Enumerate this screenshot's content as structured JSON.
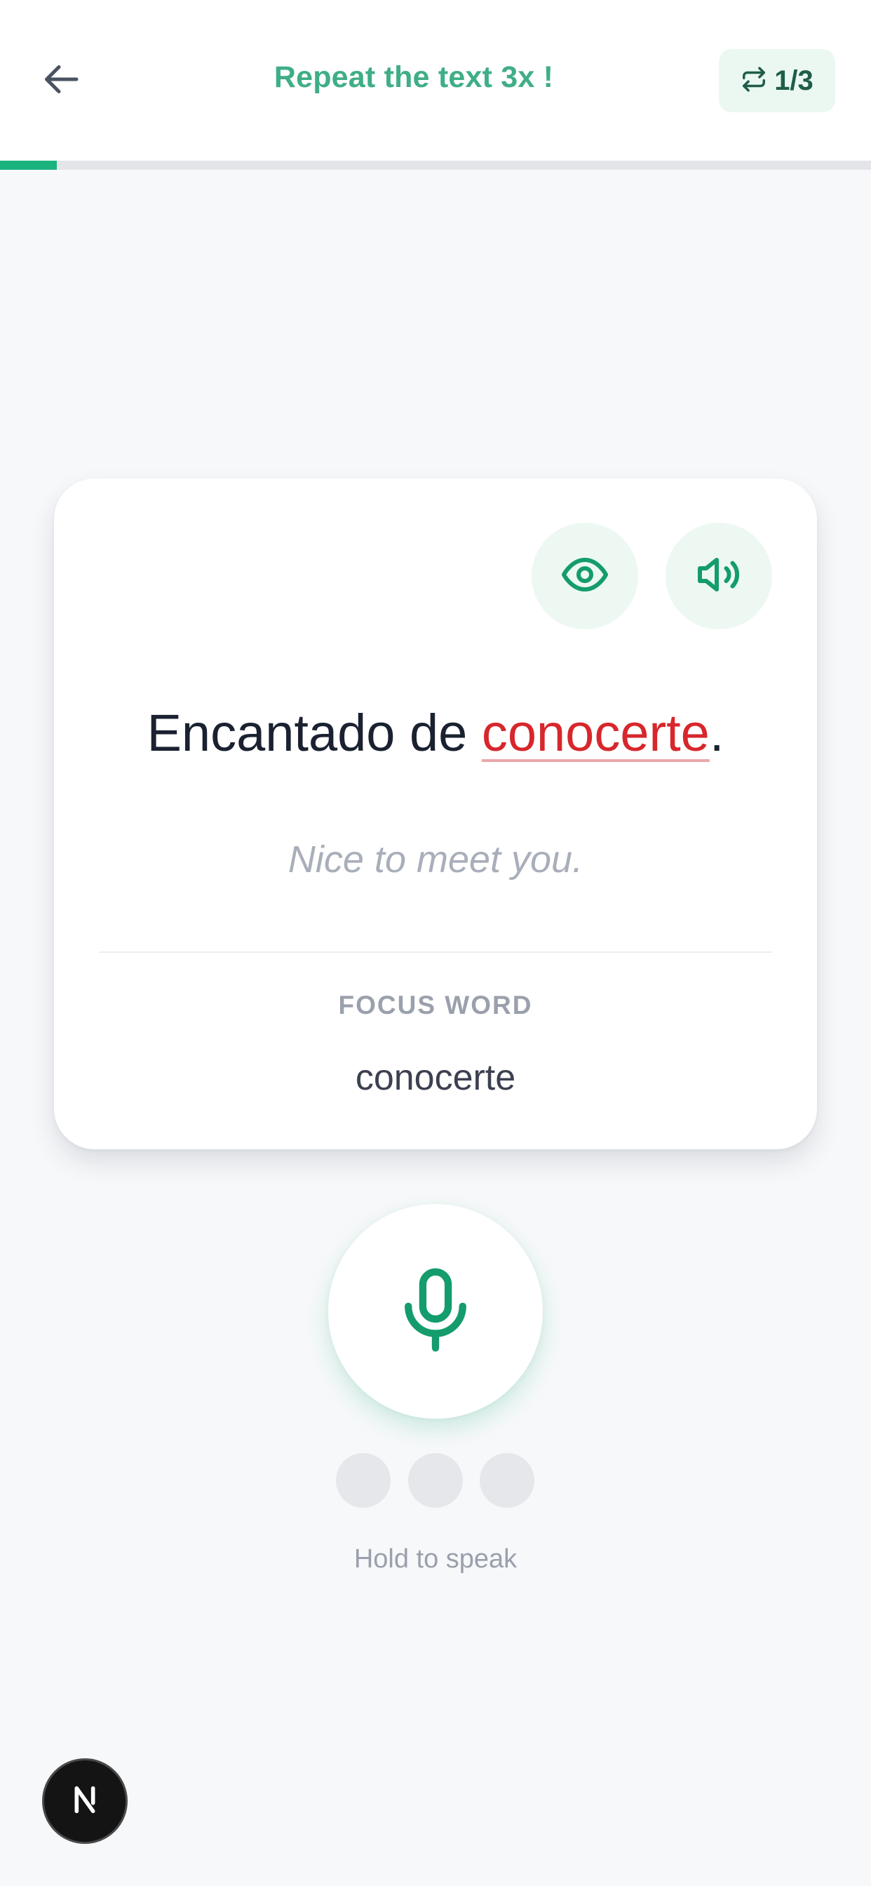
{
  "header": {
    "title": "Repeat the text 3x !",
    "counter": "1/3",
    "back_icon": "arrow-left-icon",
    "counter_icon": "repeat-icon"
  },
  "progress": {
    "fraction": 0.065
  },
  "card": {
    "sentence_before": "Encantado de ",
    "sentence_focus": "conocerte",
    "sentence_after": ".",
    "translation": "Nice to meet you.",
    "focus_label": "FOCUS WORD",
    "focus_word": "conocerte",
    "eye_icon": "eye-icon",
    "speaker_icon": "speaker-icon"
  },
  "speak": {
    "hint": "Hold to speak",
    "attempts_total": 3,
    "attempts_done": 0,
    "mic_icon": "microphone-icon"
  },
  "dev_badge": {
    "letter": "N"
  },
  "colors": {
    "accent": "#1ab37e",
    "title": "#3fae86",
    "focus": "#d7272c",
    "text": "#1a2130",
    "muted": "#a9aebb",
    "background": "#f7f8fa"
  }
}
